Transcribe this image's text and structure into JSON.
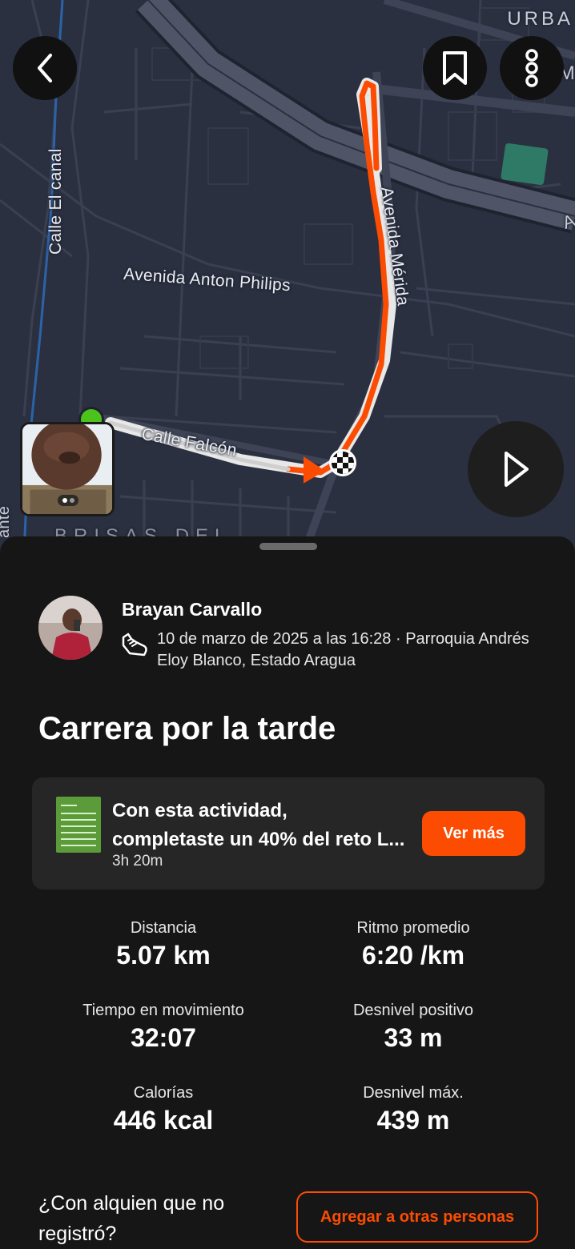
{
  "map": {
    "labels": {
      "calle_el_canal": "Calle El canal",
      "avenida_anton_philips": "Avenida Anton Philips",
      "avenida_merida": "Avenida Mérida",
      "calle_falcon": "Calle Falcón",
      "urba": "URBA",
      "m": "M",
      "a": "A",
      "ante": "ante",
      "brisas": "BRISAS DEL"
    },
    "colors": {
      "background": "#2b3040",
      "road": "#3e4456",
      "highway": "#555b6c",
      "route": "#fc4c02",
      "start_marker": "#4cc31a",
      "park": "#2f7a66"
    },
    "icons": {
      "back": "chevron-left-icon",
      "bookmark": "bookmark-icon",
      "more": "more-vertical-icon",
      "play": "play-icon",
      "finish": "checkered-flag-icon"
    }
  },
  "activity": {
    "athlete_name": "Brayan Carvallo",
    "meta": "10 de marzo de 2025 a las 16:28 · Parroquia Andrés Eloy Blanco, Estado Aragua",
    "sport_icon": "running-shoe-icon",
    "title": "Carrera por la tarde"
  },
  "challenge": {
    "line1": "Con esta actividad,",
    "line2": "completaste un 40% del reto L...",
    "duration": "3h 20m",
    "button": "Ver más"
  },
  "stats": {
    "distance": {
      "label": "Distancia",
      "value": "5.07 km"
    },
    "pace": {
      "label": "Ritmo promedio",
      "value": "6:20 /km"
    },
    "moving_time": {
      "label": "Tiempo en movimiento",
      "value": "32:07"
    },
    "elevation_gain": {
      "label": "Desnivel positivo",
      "value": "33 m"
    },
    "calories": {
      "label": "Calorías",
      "value": "446 kcal"
    },
    "max_elevation": {
      "label": "Desnivel máx.",
      "value": "439 m"
    }
  },
  "footer": {
    "question": "¿Con alquien que no registró?",
    "add_button": "Agregar a otras personas"
  },
  "accent_color": "#fc4c02"
}
